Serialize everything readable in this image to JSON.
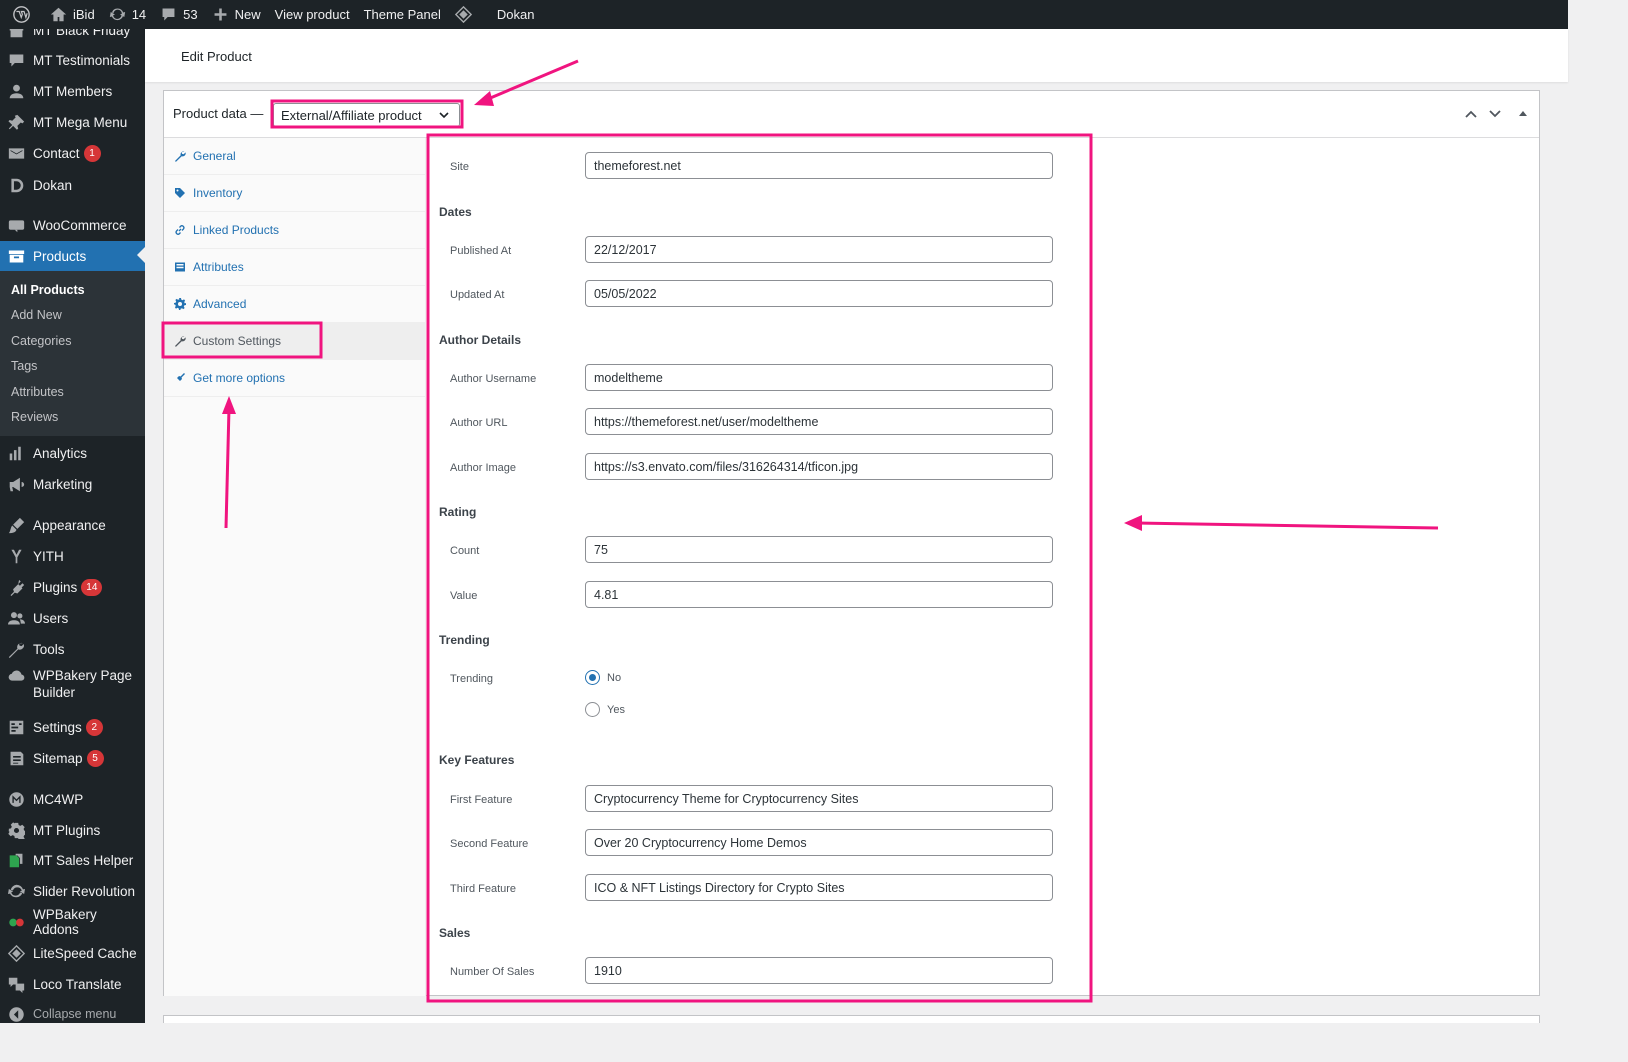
{
  "adminbar": {
    "site_name": "iBid",
    "updates_count": "14",
    "comments_count": "53",
    "new_label": "New",
    "view_product": "View product",
    "theme_panel": "Theme Panel",
    "dokan": "Dokan"
  },
  "sidebar": {
    "items": [
      {
        "label": "MT Black Friday",
        "icon": "gift-icon"
      },
      {
        "label": "MT Testimonials",
        "icon": "comment-icon"
      },
      {
        "label": "MT Members",
        "icon": "user-icon"
      },
      {
        "label": "MT Mega Menu",
        "icon": "pin-icon"
      },
      {
        "label": "Contact",
        "badge": "1",
        "icon": "mail-icon"
      },
      {
        "label": "Dokan",
        "icon": "dokan-icon"
      },
      {
        "label": "WooCommerce",
        "icon": "woo-icon"
      },
      {
        "label": "Products",
        "icon": "archive-icon"
      },
      {
        "label": "Analytics",
        "icon": "chart-icon"
      },
      {
        "label": "Marketing",
        "icon": "megaphone-icon"
      },
      {
        "label": "Appearance",
        "icon": "brush-icon"
      },
      {
        "label": "YITH",
        "icon": "yith-icon"
      },
      {
        "label": "Plugins",
        "badge": "14",
        "icon": "plug-icon"
      },
      {
        "label": "Users",
        "icon": "users-icon"
      },
      {
        "label": "Tools",
        "icon": "wrench-icon"
      },
      {
        "label": "WPBakery Page Builder",
        "icon": "cloud-icon"
      },
      {
        "label": "Settings",
        "badge": "2",
        "icon": "settings-icon"
      },
      {
        "label": "Sitemap",
        "badge": "5",
        "icon": "sitemap-icon"
      },
      {
        "label": "MC4WP",
        "icon": "mc4wp-icon"
      },
      {
        "label": "MT Plugins",
        "icon": "gear-icon"
      },
      {
        "label": "MT Sales Helper",
        "icon": "sales-icon"
      },
      {
        "label": "Slider Revolution",
        "icon": "refresh-icon"
      },
      {
        "label": "WPBakery Addons",
        "icon": "addons-icon"
      },
      {
        "label": "LiteSpeed Cache",
        "icon": "diamond-icon"
      },
      {
        "label": "Loco Translate",
        "icon": "translate-icon"
      },
      {
        "label": "Collapse menu",
        "icon": "collapse-icon"
      }
    ],
    "submenu": [
      "All Products",
      "Add New",
      "Categories",
      "Tags",
      "Attributes",
      "Reviews"
    ]
  },
  "page": {
    "title": "Edit Product"
  },
  "product_data": {
    "label": "Product data —",
    "type_value": "External/Affiliate product",
    "tabs": [
      "General",
      "Inventory",
      "Linked Products",
      "Attributes",
      "Advanced",
      "Custom Settings",
      "Get more options"
    ],
    "active_tab": "Custom Settings"
  },
  "custom_settings": {
    "site": {
      "label": "Site",
      "value": "themeforest.net"
    },
    "dates": {
      "heading": "Dates",
      "published": {
        "label": "Published At",
        "value": "22/12/2017"
      },
      "updated": {
        "label": "Updated At",
        "value": "05/05/2022"
      }
    },
    "author": {
      "heading": "Author Details",
      "username": {
        "label": "Author Username",
        "value": "modeltheme"
      },
      "url": {
        "label": "Author URL",
        "value": "https://themeforest.net/user/modeltheme"
      },
      "image": {
        "label": "Author Image",
        "value": "https://s3.envato.com/files/316264314/tficon.jpg"
      }
    },
    "rating": {
      "heading": "Rating",
      "count": {
        "label": "Count",
        "value": "75"
      },
      "value": {
        "label": "Value",
        "value": "4.81"
      }
    },
    "trending": {
      "heading": "Trending",
      "label": "Trending",
      "options": [
        "No",
        "Yes"
      ],
      "selected": "No"
    },
    "features": {
      "heading": "Key Features",
      "first": {
        "label": "First Feature",
        "value": "Cryptocurrency Theme for Cryptocurrency Sites"
      },
      "second": {
        "label": "Second Feature",
        "value": "Over 20 Cryptocurrency Home Demos"
      },
      "third": {
        "label": "Third Feature",
        "value": "ICO & NFT Listings Directory for Crypto Sites"
      }
    },
    "sales": {
      "heading": "Sales",
      "number": {
        "label": "Number Of Sales",
        "value": "1910"
      }
    }
  },
  "colors": {
    "admin_dark": "#1d2327",
    "admin_blue": "#2271b1",
    "highlight_pink": "#f0147f",
    "badge_red": "#d63638"
  }
}
